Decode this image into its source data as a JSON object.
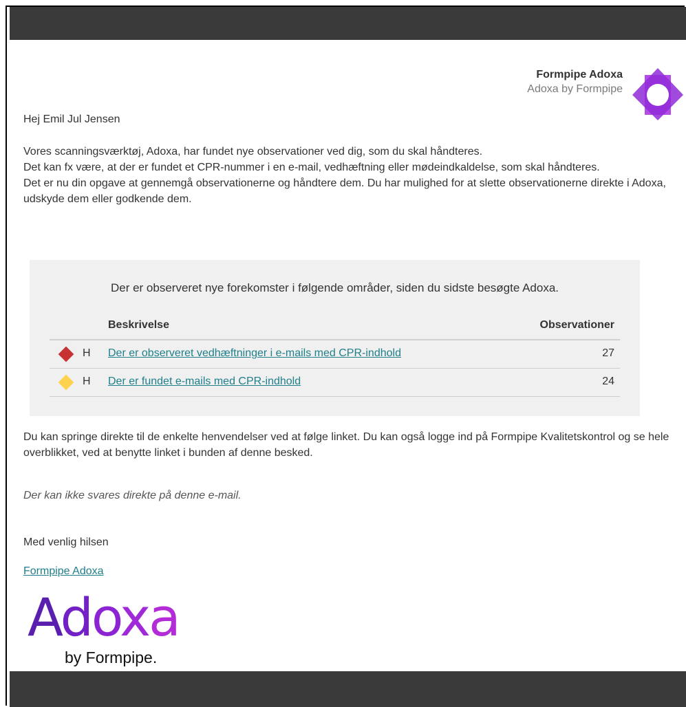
{
  "header": {
    "brand_name": "Formpipe Adoxa",
    "brand_sub": "Adoxa by Formpipe",
    "logo_icon": "purple-octagram-icon"
  },
  "greeting": "Hej Emil Jul Jensen",
  "intro_lines": [
    "Vores scanningsværktøj, Adoxa, har fundet nye observationer ved dig, som du skal håndteres.",
    "Det kan fx være, at der er fundet et CPR-nummer i en e-mail, vedhæftning eller mødeindkaldelse, som skal håndteres.",
    "Det er nu din opgave at gennemgå observationerne og håndtere dem. Du har mulighed for at slette observationerne direkte i Adoxa, udskyde dem eller godkende dem."
  ],
  "notice": {
    "heading": "Der er observeret nye forekomster i følgende områder, siden du sidste besøgte Adoxa.",
    "columns": {
      "description": "Beskrivelse",
      "observations": "Observationer"
    },
    "rows": [
      {
        "icon": "red-diamond-icon",
        "color": "#c83232",
        "priority": "H",
        "description": "Der er observeret vedhæftninger i e-mails med CPR-indhold",
        "count": "27"
      },
      {
        "icon": "yellow-diamond-icon",
        "color": "#ffd24d",
        "priority": "H",
        "description": "Der er fundet e-mails med CPR-indhold",
        "count": "24"
      }
    ]
  },
  "follow_text": "Du kan springe direkte til de enkelte henvendelser ved at følge linket. Du kan også logge ind på Formpipe Kvalitetskontrol og se hele overblikket, ved at benytte linket i bunden af denne besked.",
  "no_reply": "Der kan ikke svares direkte på denne e-mail.",
  "closing": "Med venlig hilsen",
  "signature_link": "Formpipe Adoxa",
  "footer_logo": {
    "word": "Adoxa",
    "tagline": "by Formpipe.",
    "colors": [
      "#5b1fb0",
      "#8d24d4",
      "#b42cd8"
    ]
  },
  "colors": {
    "dark_bar": "#3a3a3a",
    "link": "#1f7f8a",
    "notice_bg": "#f0f0f0"
  }
}
